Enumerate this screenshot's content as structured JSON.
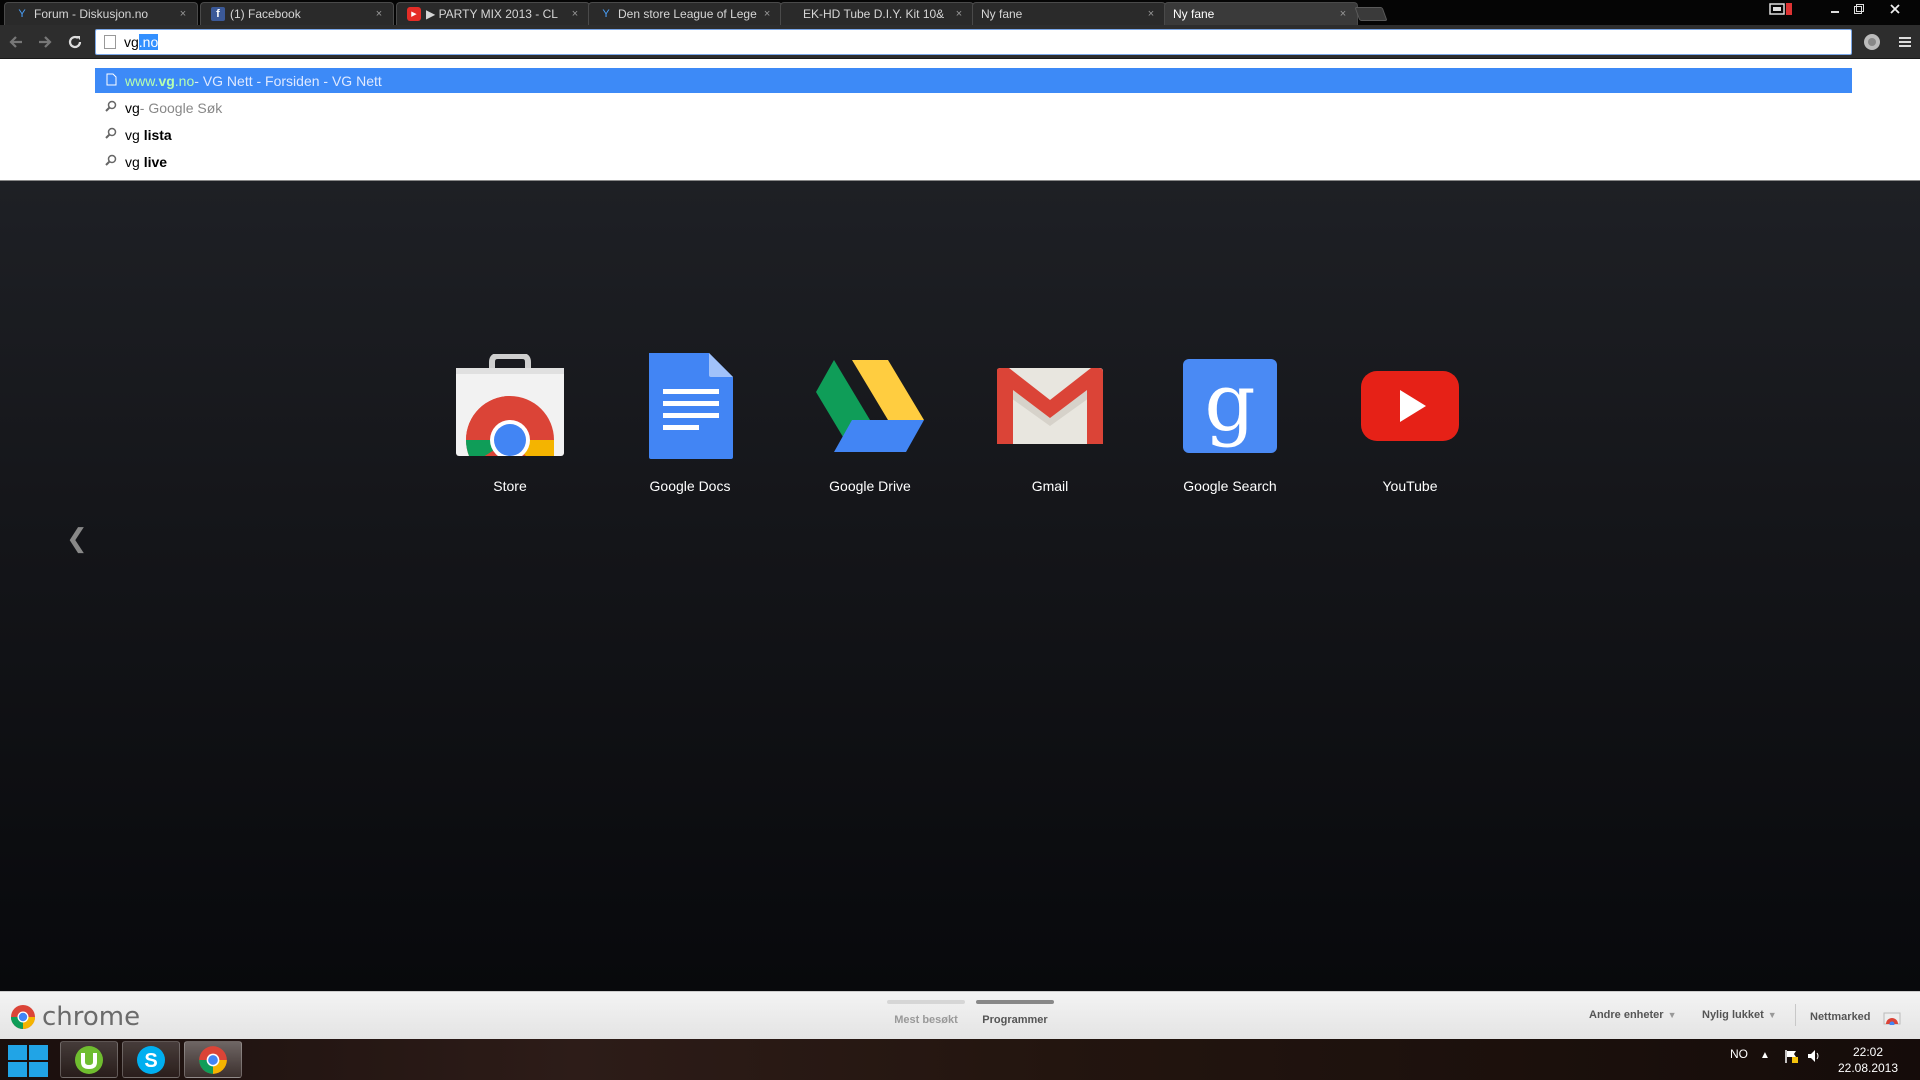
{
  "tabs": [
    {
      "title": "Forum - Diskusjon.no",
      "icon": "diskusjon-favicon-icon"
    },
    {
      "title": "(1) Facebook",
      "icon": "facebook-favicon-icon"
    },
    {
      "title": "▶ PARTY MIX 2013 - CL",
      "icon": "youtube-favicon-icon"
    },
    {
      "title": "Den store League of Leger",
      "icon": "diskusjon-favicon-icon"
    },
    {
      "title": "EK-HD Tube D.I.Y. Kit 10&",
      "icon": "none"
    },
    {
      "title": "Ny fane",
      "icon": "none"
    },
    {
      "title": "Ny fane",
      "icon": "none",
      "active": true
    }
  ],
  "tab_close_glyph": "×",
  "omnibox": {
    "typed": "vg",
    "autocomplete": ".no"
  },
  "suggestions": [
    {
      "url": "www.vg.no",
      "url_prefix": "www.",
      "url_bold": "vg",
      "url_suffix": ".no",
      "desc": " - VG Nett - Forsiden - VG Nett",
      "icon": "page-icon"
    },
    {
      "text": "vg",
      "desc": " - Google Søk",
      "icon": "search-icon"
    },
    {
      "text": "vg ",
      "bold": "lista",
      "icon": "search-icon"
    },
    {
      "text": "vg ",
      "bold": "live",
      "icon": "search-icon"
    }
  ],
  "apps": [
    {
      "label": "Store"
    },
    {
      "label": "Google Docs"
    },
    {
      "label": "Google Drive"
    },
    {
      "label": "Gmail"
    },
    {
      "label": "Google Search"
    },
    {
      "label": "YouTube"
    }
  ],
  "prev_page_glyph": "❮",
  "bottombar": {
    "brand": "chrome",
    "pages": [
      {
        "label": "Mest besøkt",
        "selected": false
      },
      {
        "label": "Programmer",
        "selected": true
      }
    ],
    "menus": [
      {
        "label": "Andre enheter"
      },
      {
        "label": "Nylig lukket"
      },
      {
        "label": "Nettmarked"
      }
    ]
  },
  "taskbar": {
    "language": "NO",
    "time": "22:02",
    "date": "22.08.2013"
  },
  "colors": {
    "omnibox_selection": "#3390ff",
    "suggestion_highlight": "#3d8af7",
    "suggestion_url": "#b6ffb0",
    "ntp_background": "#15161a"
  }
}
